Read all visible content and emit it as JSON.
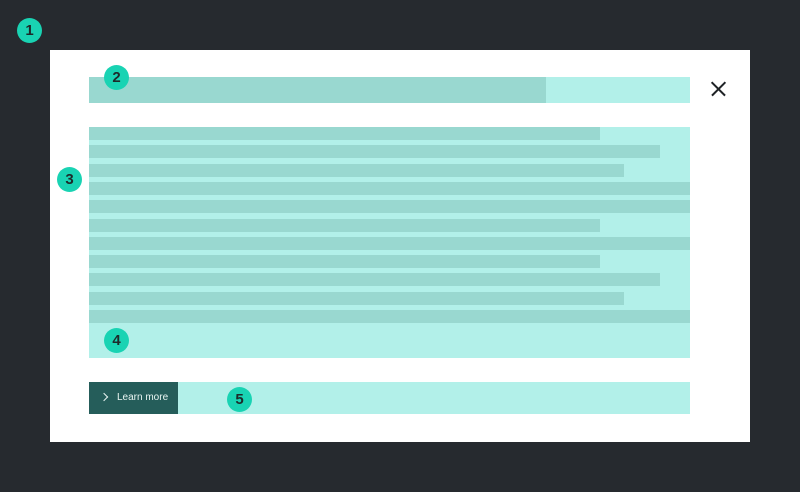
{
  "colors": {
    "background": "#262a2f",
    "modal": "#ffffff",
    "region_light": "#b2f0e9",
    "placeholder": "#99d8d0",
    "badge": "#19d3b3",
    "button": "#255d5a",
    "button_text": "#e9f5f2",
    "close_icon": "#1f2326"
  },
  "badges": [
    "1",
    "2",
    "3",
    "4",
    "5"
  ],
  "modal": {
    "close_icon": "close-icon",
    "title_placeholder_fraction": 0.76,
    "body_line_fractions": [
      0.85,
      0.95,
      0.89,
      1.0,
      1.0,
      0.85,
      1.0,
      0.85,
      0.95,
      0.89,
      1.0
    ],
    "footer": {
      "button_label": "Learn more",
      "button_icon": "chevron-right-icon"
    }
  }
}
